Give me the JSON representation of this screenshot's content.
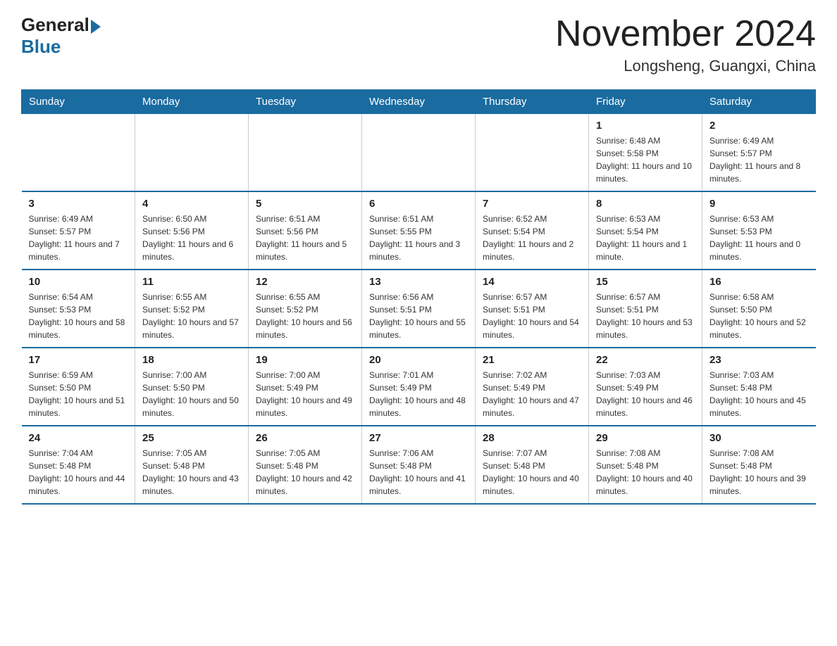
{
  "header": {
    "logo_general": "General",
    "logo_blue": "Blue",
    "title": "November 2024",
    "subtitle": "Longsheng, Guangxi, China"
  },
  "days_of_week": [
    "Sunday",
    "Monday",
    "Tuesday",
    "Wednesday",
    "Thursday",
    "Friday",
    "Saturday"
  ],
  "weeks": [
    [
      {
        "num": "",
        "info": ""
      },
      {
        "num": "",
        "info": ""
      },
      {
        "num": "",
        "info": ""
      },
      {
        "num": "",
        "info": ""
      },
      {
        "num": "",
        "info": ""
      },
      {
        "num": "1",
        "info": "Sunrise: 6:48 AM\nSunset: 5:58 PM\nDaylight: 11 hours and 10 minutes."
      },
      {
        "num": "2",
        "info": "Sunrise: 6:49 AM\nSunset: 5:57 PM\nDaylight: 11 hours and 8 minutes."
      }
    ],
    [
      {
        "num": "3",
        "info": "Sunrise: 6:49 AM\nSunset: 5:57 PM\nDaylight: 11 hours and 7 minutes."
      },
      {
        "num": "4",
        "info": "Sunrise: 6:50 AM\nSunset: 5:56 PM\nDaylight: 11 hours and 6 minutes."
      },
      {
        "num": "5",
        "info": "Sunrise: 6:51 AM\nSunset: 5:56 PM\nDaylight: 11 hours and 5 minutes."
      },
      {
        "num": "6",
        "info": "Sunrise: 6:51 AM\nSunset: 5:55 PM\nDaylight: 11 hours and 3 minutes."
      },
      {
        "num": "7",
        "info": "Sunrise: 6:52 AM\nSunset: 5:54 PM\nDaylight: 11 hours and 2 minutes."
      },
      {
        "num": "8",
        "info": "Sunrise: 6:53 AM\nSunset: 5:54 PM\nDaylight: 11 hours and 1 minute."
      },
      {
        "num": "9",
        "info": "Sunrise: 6:53 AM\nSunset: 5:53 PM\nDaylight: 11 hours and 0 minutes."
      }
    ],
    [
      {
        "num": "10",
        "info": "Sunrise: 6:54 AM\nSunset: 5:53 PM\nDaylight: 10 hours and 58 minutes."
      },
      {
        "num": "11",
        "info": "Sunrise: 6:55 AM\nSunset: 5:52 PM\nDaylight: 10 hours and 57 minutes."
      },
      {
        "num": "12",
        "info": "Sunrise: 6:55 AM\nSunset: 5:52 PM\nDaylight: 10 hours and 56 minutes."
      },
      {
        "num": "13",
        "info": "Sunrise: 6:56 AM\nSunset: 5:51 PM\nDaylight: 10 hours and 55 minutes."
      },
      {
        "num": "14",
        "info": "Sunrise: 6:57 AM\nSunset: 5:51 PM\nDaylight: 10 hours and 54 minutes."
      },
      {
        "num": "15",
        "info": "Sunrise: 6:57 AM\nSunset: 5:51 PM\nDaylight: 10 hours and 53 minutes."
      },
      {
        "num": "16",
        "info": "Sunrise: 6:58 AM\nSunset: 5:50 PM\nDaylight: 10 hours and 52 minutes."
      }
    ],
    [
      {
        "num": "17",
        "info": "Sunrise: 6:59 AM\nSunset: 5:50 PM\nDaylight: 10 hours and 51 minutes."
      },
      {
        "num": "18",
        "info": "Sunrise: 7:00 AM\nSunset: 5:50 PM\nDaylight: 10 hours and 50 minutes."
      },
      {
        "num": "19",
        "info": "Sunrise: 7:00 AM\nSunset: 5:49 PM\nDaylight: 10 hours and 49 minutes."
      },
      {
        "num": "20",
        "info": "Sunrise: 7:01 AM\nSunset: 5:49 PM\nDaylight: 10 hours and 48 minutes."
      },
      {
        "num": "21",
        "info": "Sunrise: 7:02 AM\nSunset: 5:49 PM\nDaylight: 10 hours and 47 minutes."
      },
      {
        "num": "22",
        "info": "Sunrise: 7:03 AM\nSunset: 5:49 PM\nDaylight: 10 hours and 46 minutes."
      },
      {
        "num": "23",
        "info": "Sunrise: 7:03 AM\nSunset: 5:48 PM\nDaylight: 10 hours and 45 minutes."
      }
    ],
    [
      {
        "num": "24",
        "info": "Sunrise: 7:04 AM\nSunset: 5:48 PM\nDaylight: 10 hours and 44 minutes."
      },
      {
        "num": "25",
        "info": "Sunrise: 7:05 AM\nSunset: 5:48 PM\nDaylight: 10 hours and 43 minutes."
      },
      {
        "num": "26",
        "info": "Sunrise: 7:05 AM\nSunset: 5:48 PM\nDaylight: 10 hours and 42 minutes."
      },
      {
        "num": "27",
        "info": "Sunrise: 7:06 AM\nSunset: 5:48 PM\nDaylight: 10 hours and 41 minutes."
      },
      {
        "num": "28",
        "info": "Sunrise: 7:07 AM\nSunset: 5:48 PM\nDaylight: 10 hours and 40 minutes."
      },
      {
        "num": "29",
        "info": "Sunrise: 7:08 AM\nSunset: 5:48 PM\nDaylight: 10 hours and 40 minutes."
      },
      {
        "num": "30",
        "info": "Sunrise: 7:08 AM\nSunset: 5:48 PM\nDaylight: 10 hours and 39 minutes."
      }
    ]
  ],
  "colors": {
    "header_bg": "#1a6ba0",
    "header_text": "#ffffff",
    "border": "#1a6ba0",
    "text": "#333333"
  }
}
